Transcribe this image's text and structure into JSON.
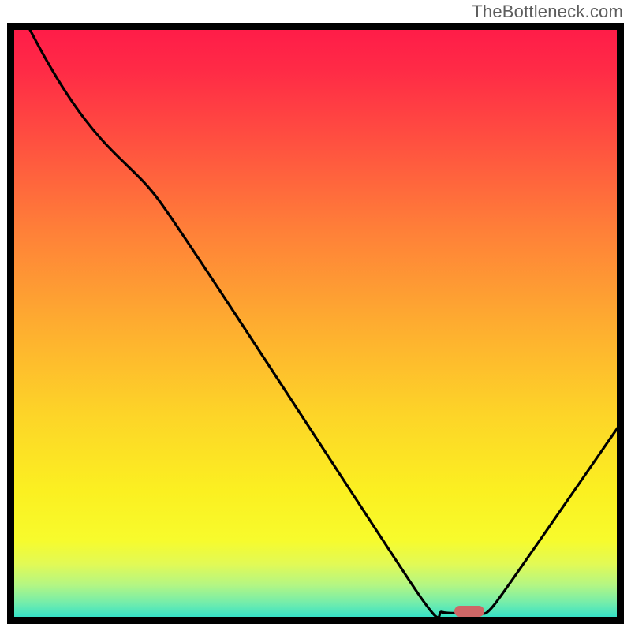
{
  "watermark": "TheBottleneck.com",
  "chart_data": {
    "type": "line",
    "title": "",
    "xlabel": "",
    "ylabel": "",
    "x_range": [
      0,
      100
    ],
    "y_range": [
      0,
      100
    ],
    "curve": [
      {
        "x": 2.5,
        "y": 100
      },
      {
        "x": 11,
        "y": 82
      },
      {
        "x": 24,
        "y": 71
      },
      {
        "x": 67,
        "y": 4
      },
      {
        "x": 71,
        "y": 0.8
      },
      {
        "x": 77,
        "y": 0.8
      },
      {
        "x": 80,
        "y": 2.5
      },
      {
        "x": 100,
        "y": 32
      }
    ],
    "marker": {
      "x": 75.5,
      "y": 0.9,
      "color": "#ce6666"
    },
    "gradient_stops": [
      {
        "offset": 0.0,
        "color": "#ff1a49"
      },
      {
        "offset": 0.08,
        "color": "#ff2b46"
      },
      {
        "offset": 0.2,
        "color": "#ff5140"
      },
      {
        "offset": 0.35,
        "color": "#ff8138"
      },
      {
        "offset": 0.5,
        "color": "#feac30"
      },
      {
        "offset": 0.65,
        "color": "#fdd428"
      },
      {
        "offset": 0.78,
        "color": "#fbf021"
      },
      {
        "offset": 0.86,
        "color": "#f7fb2c"
      },
      {
        "offset": 0.9,
        "color": "#e2fa55"
      },
      {
        "offset": 0.935,
        "color": "#b4f683"
      },
      {
        "offset": 0.965,
        "color": "#74edab"
      },
      {
        "offset": 0.985,
        "color": "#3fe3c3"
      },
      {
        "offset": 1.0,
        "color": "#12d9d4"
      }
    ]
  },
  "colors": {
    "frame": "#000000",
    "curve": "#000000",
    "watermark": "#5d5d5d"
  }
}
